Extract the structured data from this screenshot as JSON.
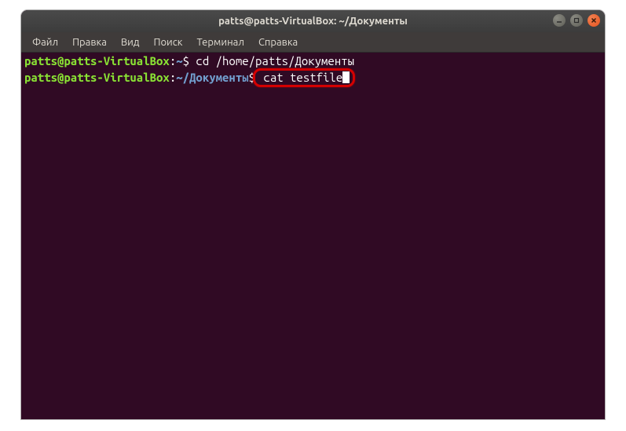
{
  "window": {
    "title": "patts@patts-VirtualBox: ~/Документы"
  },
  "menu": {
    "file": "Файл",
    "edit": "Правка",
    "view": "Вид",
    "search": "Поиск",
    "terminal": "Терминал",
    "help": "Справка"
  },
  "terminal": {
    "line1": {
      "userhost": "patts@patts-VirtualBox",
      "colon": ":",
      "path": "~",
      "dollar": "$",
      "command": " cd /home/patts/Документы"
    },
    "line2": {
      "userhost": "patts@patts-VirtualBox",
      "colon": ":",
      "path": "~/Документы",
      "dollar": "$",
      "command": " cat testfile"
    }
  }
}
